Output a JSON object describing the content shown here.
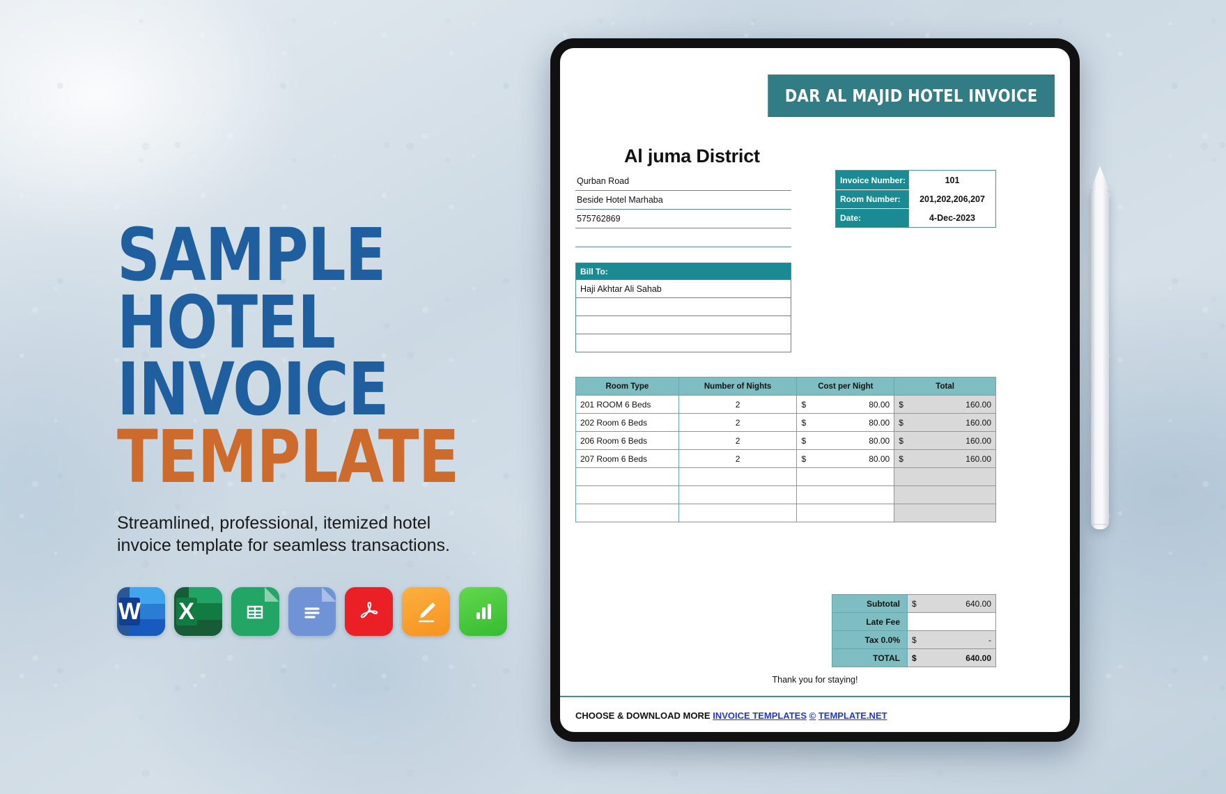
{
  "promo": {
    "headline_lines": [
      "SAMPLE",
      "HOTEL",
      "INVOICE"
    ],
    "headline_accent": "TEMPLATE",
    "subtitle": "Streamlined, professional, itemized hotel invoice template for seamless transactions.",
    "colors": {
      "headline": "#1f5fa0",
      "accent": "#cc6b2c"
    },
    "app_icons": [
      {
        "name": "word-icon",
        "glyph": "W"
      },
      {
        "name": "excel-icon",
        "glyph": "X"
      },
      {
        "name": "google-sheets-icon",
        "glyph": ""
      },
      {
        "name": "google-docs-icon",
        "glyph": ""
      },
      {
        "name": "pdf-icon",
        "glyph": ""
      },
      {
        "name": "apple-pages-icon",
        "glyph": ""
      },
      {
        "name": "apple-numbers-icon",
        "glyph": ""
      }
    ]
  },
  "invoice": {
    "banner_title": "DAR AL MAJID HOTEL INVOICE",
    "company_name": "Al juma District",
    "address_lines": [
      "Qurban Road",
      "Beside Hotel Marhaba",
      "575762869",
      ""
    ],
    "meta": [
      {
        "label": "Invoice Number:",
        "value": "101"
      },
      {
        "label": "Room Number:",
        "value": "201,202,206,207"
      },
      {
        "label": "Date:",
        "value": "4-Dec-2023"
      }
    ],
    "bill_to_label": "Bill To:",
    "bill_to_lines": [
      "Haji Akhtar Ali Sahab",
      "",
      "",
      ""
    ],
    "table": {
      "headers": [
        "Room Type",
        "Number of Nights",
        "Cost per Night",
        "Total"
      ],
      "rows": [
        {
          "type": "201 ROOM 6 Beds",
          "nights": "2",
          "cost_sym": "$",
          "cost": "80.00",
          "total_sym": "$",
          "total": "160.00"
        },
        {
          "type": "202 Room 6 Beds",
          "nights": "2",
          "cost_sym": "$",
          "cost": "80.00",
          "total_sym": "$",
          "total": "160.00"
        },
        {
          "type": "206 Room 6 Beds",
          "nights": "2",
          "cost_sym": "$",
          "cost": "80.00",
          "total_sym": "$",
          "total": "160.00"
        },
        {
          "type": "207 Room 6 Beds",
          "nights": "2",
          "cost_sym": "$",
          "cost": "80.00",
          "total_sym": "$",
          "total": "160.00"
        }
      ],
      "empty_rows": 3
    },
    "totals": [
      {
        "label": "Subtotal",
        "sym": "$",
        "value": "640.00",
        "shaded": true
      },
      {
        "label": "Late Fee",
        "sym": "",
        "value": "",
        "shaded": false
      },
      {
        "label": "Tax  0.0%",
        "sym": "$",
        "value": "-",
        "shaded": true
      },
      {
        "label": "TOTAL",
        "sym": "$",
        "value": "640.00",
        "shaded": true
      }
    ],
    "thanks": "Thank you for staying!",
    "attribution": {
      "prefix": "CHOOSE & DOWNLOAD MORE",
      "link1": "INVOICE TEMPLATES",
      "copyright": "©",
      "link2": "TEMPLATE.NET"
    },
    "colors": {
      "banner": "#317c85",
      "header_teal": "#1a8b93",
      "table_head": "#7ebec2",
      "shaded": "#d9d9d9"
    }
  }
}
